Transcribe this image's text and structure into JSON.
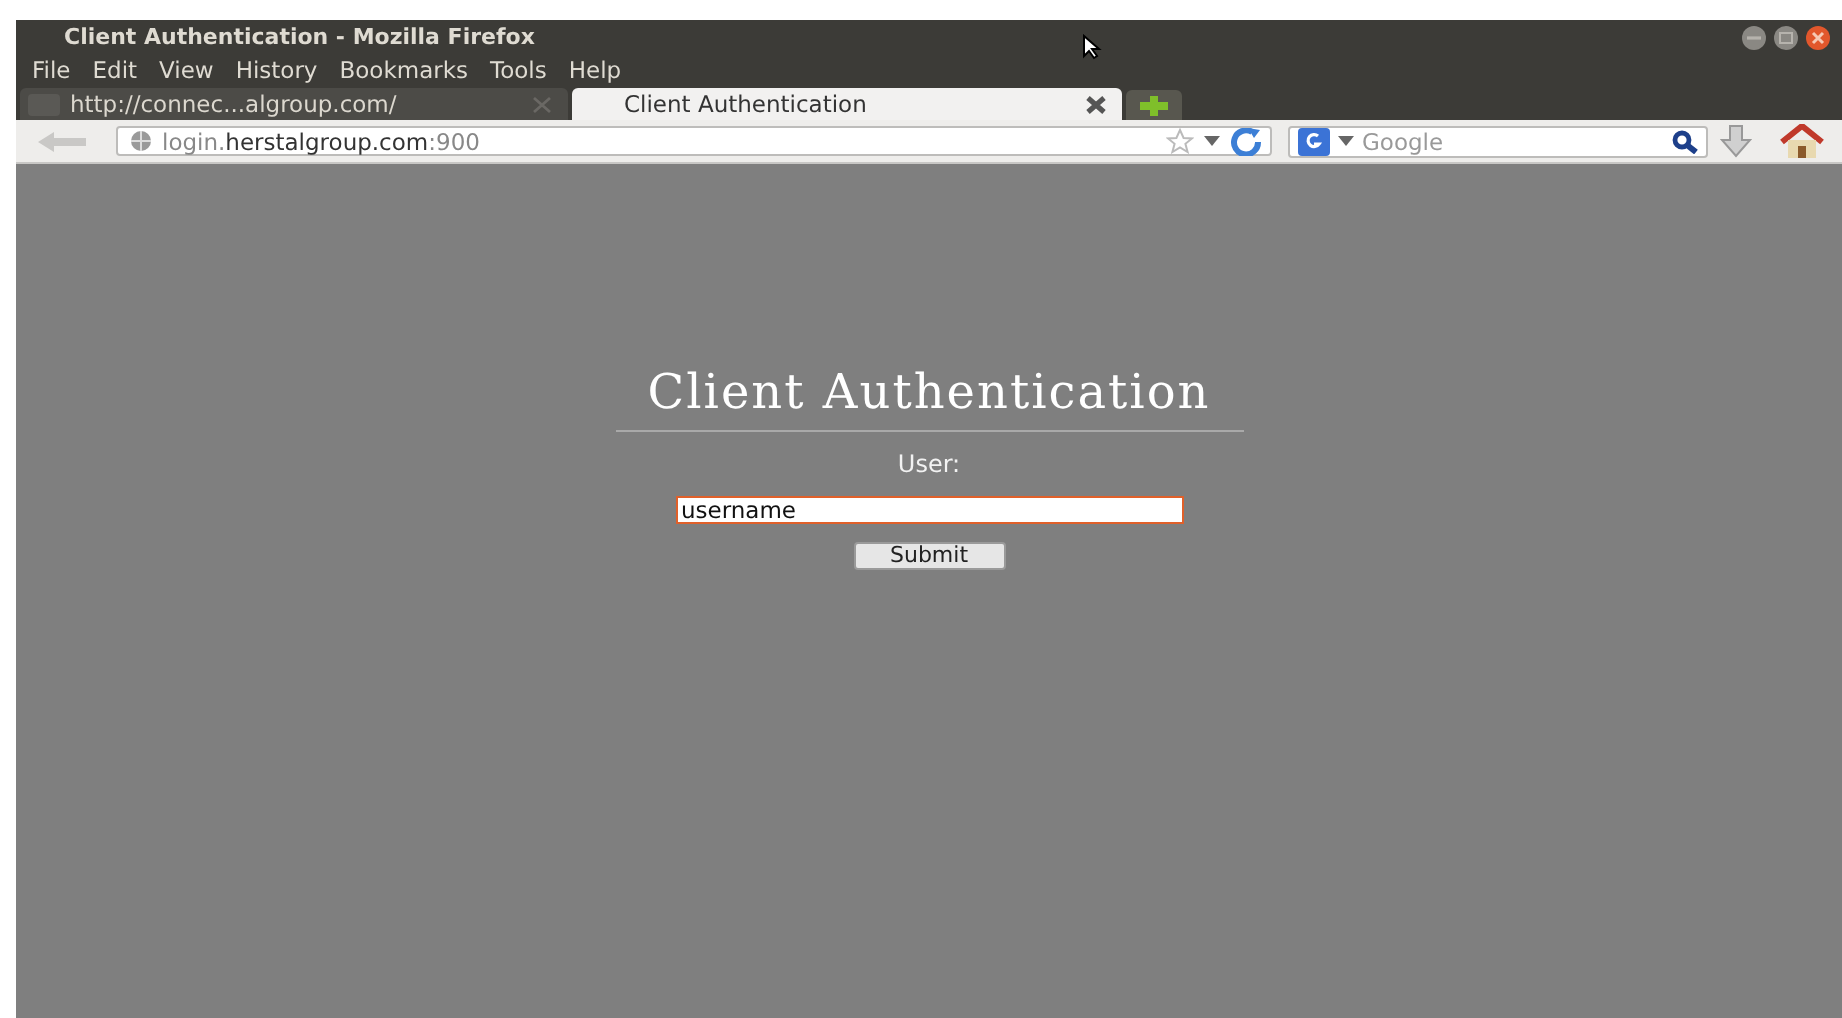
{
  "window": {
    "title": "Client Authentication - Mozilla Firefox"
  },
  "menu": [
    "File",
    "Edit",
    "View",
    "History",
    "Bookmarks",
    "Tools",
    "Help"
  ],
  "tabs": [
    {
      "label": "http://connec...algroup.com/",
      "selected": false
    },
    {
      "label": "Client Authentication",
      "selected": true
    }
  ],
  "address": {
    "url": "login.**herstalgroup.com**:900"
  },
  "search": {
    "placeholder": "Google"
  },
  "page": {
    "heading": "Client Authentication",
    "label": "User:",
    "field": {
      "value": "username",
      "focused": true
    },
    "button": "Submit"
  }
}
